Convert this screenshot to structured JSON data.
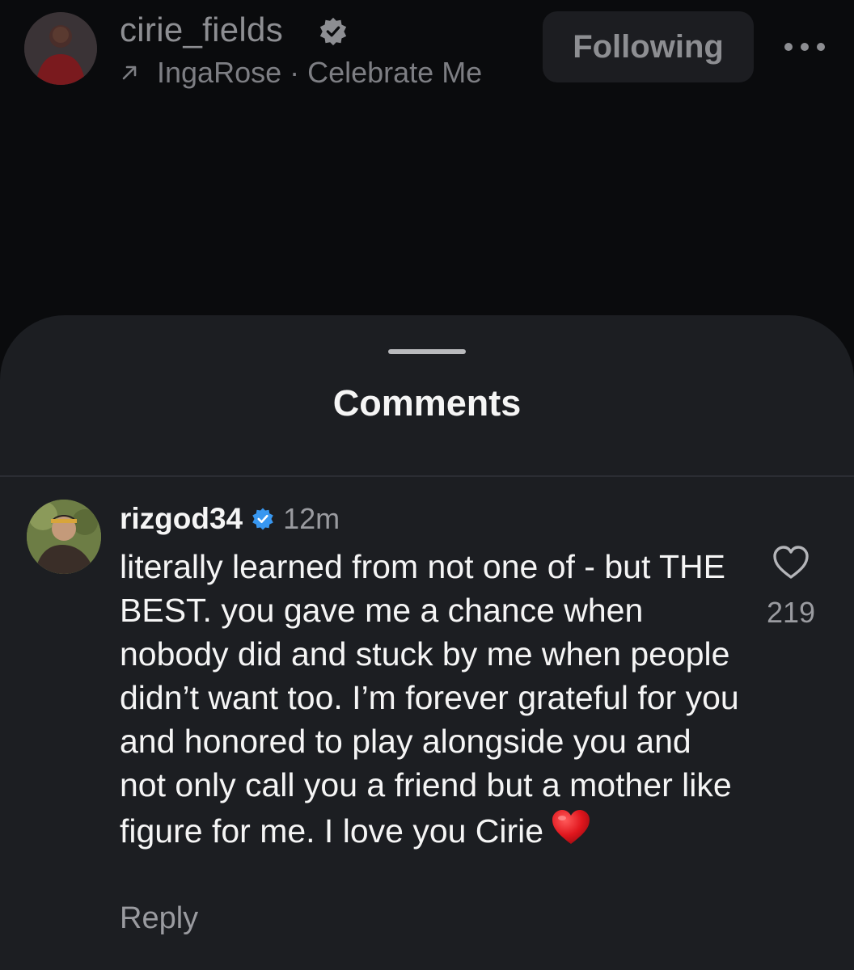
{
  "post_header": {
    "username": "cirie_fields",
    "verified_icon": "verified-badge-icon",
    "collab_arrow_icon": "arrow-up-right-icon",
    "audio_line": "IngaRose · Celebrate Me",
    "following_label": "Following",
    "more_icon": "ellipsis-icon"
  },
  "sheet": {
    "title": "Comments"
  },
  "comment": {
    "username": "rizgod34",
    "verified": true,
    "time": "12m",
    "text": "literally learned from not one of - but THE BEST. you gave me a chance when nobody did and stuck by me when people didn’t want too. I’m forever grateful for you and honored to play alongside you and not only call you a friend but a mother like figure for me. I love you Cirie",
    "emoji_icon": "red-heart-emoji-icon",
    "reply_label": "Reply",
    "like_icon": "heart-outline-icon",
    "like_count": "219"
  },
  "colors": {
    "background": "#0a0b0d",
    "sheet": "#1c1e22",
    "verified_blue": "#3897f0",
    "muted_text": "#9a9ba0"
  }
}
